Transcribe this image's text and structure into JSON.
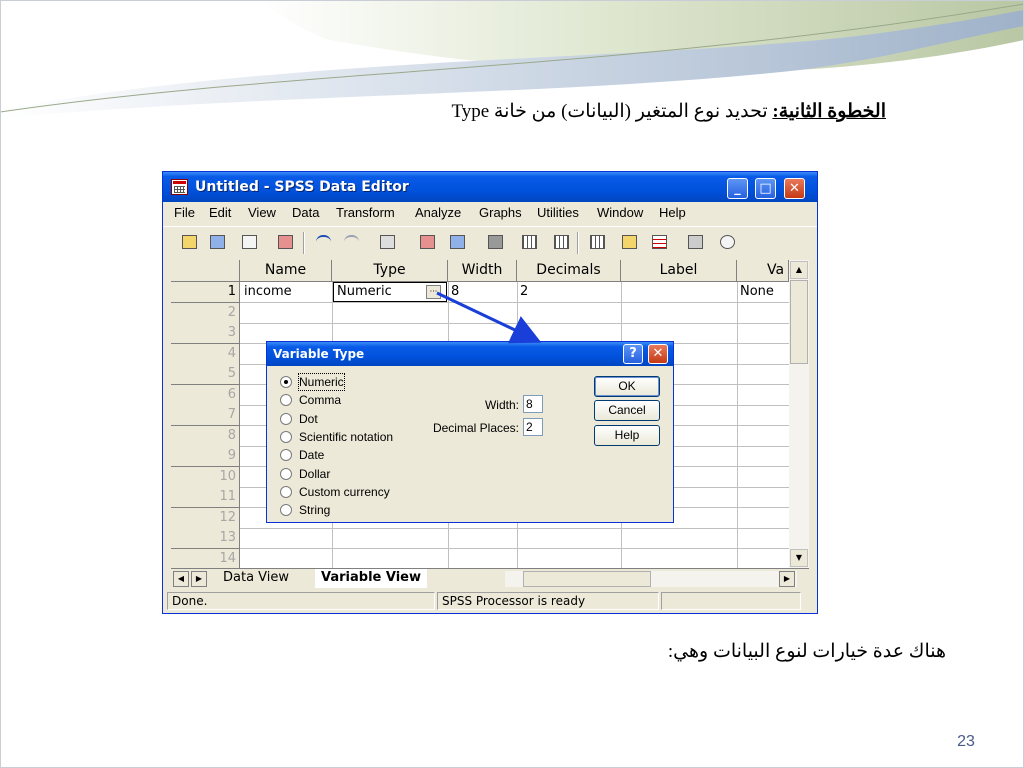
{
  "slide": {
    "step_label": "الخطوة الثانية:",
    "step_text": " تحديد نوع المتغير (البيانات) من خانة Type",
    "note": "هناك عدة خيارات لنوع البيانات وهي:",
    "page_number": "23"
  },
  "window": {
    "title": "Untitled - SPSS Data Editor",
    "controls": {
      "minimize": "_",
      "maximize": "□",
      "close": "✕"
    }
  },
  "menu": [
    "File",
    "Edit",
    "View",
    "Data",
    "Transform",
    "Analyze",
    "Graphs",
    "Utilities",
    "Window",
    "Help"
  ],
  "toolbar_icons": [
    "open-icon",
    "save-icon",
    "print-icon",
    "dialog-recall-icon",
    "undo-icon",
    "redo-icon",
    "goto-chart-icon",
    "goto-case-icon",
    "variables-icon",
    "find-icon",
    "insert-cases-icon",
    "insert-variable-icon",
    "split-file-icon",
    "weight-cases-icon",
    "select-cases-icon",
    "value-labels-icon",
    "use-sets-icon"
  ],
  "grid": {
    "columns": [
      "Name",
      "Type",
      "Width",
      "Decimals",
      "Label",
      "Va"
    ],
    "row_numbers": [
      "1",
      "2",
      "3",
      "4",
      "5",
      "6",
      "7",
      "8",
      "9",
      "10",
      "11",
      "12",
      "13",
      "14"
    ],
    "row1": {
      "name": "income",
      "type": "Numeric",
      "width": "8",
      "decimals": "2",
      "values": "None"
    }
  },
  "tabs": {
    "data_view": "Data View",
    "variable_view": "Variable View"
  },
  "status": {
    "left": "Done.",
    "processor": "SPSS Processor  is ready"
  },
  "dialog": {
    "title": "Variable Type",
    "help_glyph": "?",
    "close_glyph": "✕",
    "options": [
      "Numeric",
      "Comma",
      "Dot",
      "Scientific notation",
      "Date",
      "Dollar",
      "Custom currency",
      "String"
    ],
    "selected": "Numeric",
    "width_label": "Width:",
    "width_value": "8",
    "decimals_label": "Decimal Places:",
    "decimals_value": "2",
    "ok": "OK",
    "cancel": "Cancel",
    "help": "Help"
  },
  "colors": {
    "titlebar": "#0052dd",
    "arrow": "#1a3fd8",
    "chrome": "#ece9d8"
  }
}
